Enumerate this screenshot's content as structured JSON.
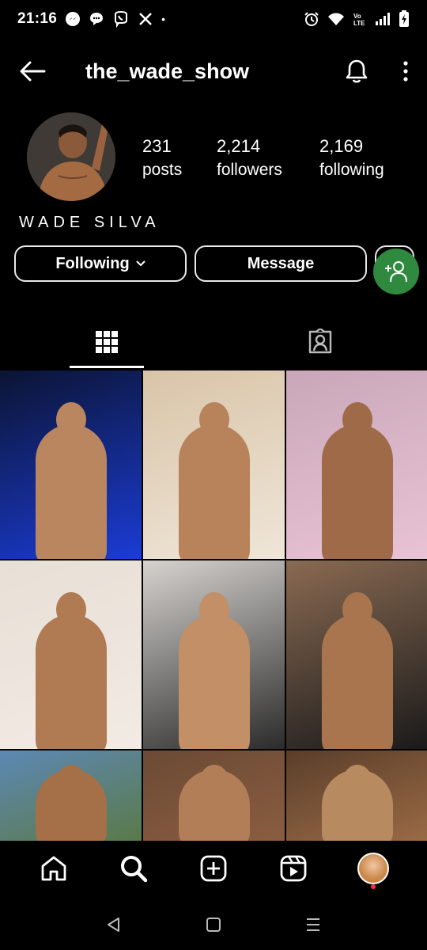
{
  "status_bar": {
    "time": "21:16",
    "left_icons": [
      "messenger-icon",
      "chat-bubble-icon",
      "viber-icon",
      "x-icon"
    ],
    "dot": "•",
    "right_icons": [
      "alarm-icon",
      "wifi-icon",
      "volte-icon",
      "signal-icon",
      "battery-icon"
    ]
  },
  "header": {
    "username": "the_wade_show"
  },
  "profile": {
    "stats": [
      {
        "number": "231",
        "label": "posts"
      },
      {
        "number": "2,214",
        "label": "followers"
      },
      {
        "number": "2,169",
        "label": "following"
      }
    ],
    "display_name": "WADE SILVA"
  },
  "actions": {
    "following_label": "Following",
    "message_label": "Message"
  },
  "grid": {
    "posts": [
      {
        "bg": "#0b1433",
        "accent": "#1b3cd6",
        "skin": "#b98660"
      },
      {
        "bg": "#d9c4a8",
        "accent": "#efe6d8",
        "skin": "#b8825a"
      },
      {
        "bg": "#c9a7b8",
        "accent": "#e8c3d6",
        "skin": "#9e6a48"
      },
      {
        "bg": "#e8dfd6",
        "accent": "#f2ebe4",
        "skin": "#b07a52"
      },
      {
        "bg": "#d6d3cf",
        "accent": "#2b2b2b",
        "skin": "#c28f66"
      },
      {
        "bg": "#8a6a52",
        "accent": "#1a1a1a",
        "skin": "#a9754e"
      },
      {
        "bg": "#5d88b5",
        "accent": "#5a7a48",
        "skin": "#a56f48"
      },
      {
        "bg": "#6b4a35",
        "accent": "#8a5d40",
        "skin": "#b27e57"
      },
      {
        "bg": "#5a3e2a",
        "accent": "#9a6a45",
        "skin": "#b88a60"
      }
    ]
  },
  "colors": {
    "background": "#000000",
    "fab": "#2f8a3f",
    "text": "#ffffff"
  }
}
